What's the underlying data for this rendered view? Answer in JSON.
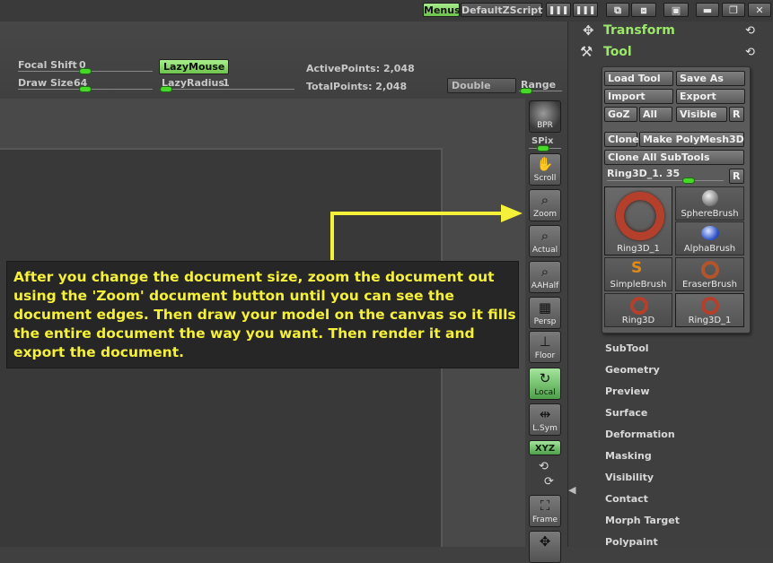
{
  "topbar": {
    "menus_label": "Menus",
    "zscript_label": "DefaultZScript"
  },
  "shelf": {
    "focal_shift_label": "Focal Shift",
    "focal_shift_value": "0",
    "draw_size_label": "Draw Size",
    "draw_size_value": "64",
    "lazymouse_label": "LazyMouse",
    "lazyradius_label": "LazyRadius",
    "lazyradius_value": "1",
    "active_points": "ActivePoints: 2,048",
    "total_points": "TotalPoints: 2,048",
    "double_label": "Double",
    "range_label": "Range"
  },
  "strip": {
    "bpr": "BPR",
    "spix": "SPix",
    "scroll": "Scroll",
    "zoom": "Zoom",
    "actual": "Actual",
    "aahalf": "AAHalf",
    "persp": "Persp",
    "floor": "Floor",
    "local": "Local",
    "lsym": "L.Sym",
    "xyz": "XYZ",
    "frame": "Frame"
  },
  "panel": {
    "transform": "Transform",
    "tool": "Tool",
    "load_tool": "Load Tool",
    "save_as": "Save As",
    "import": "Import",
    "export": "Export",
    "goz": "GoZ",
    "all": "All",
    "visible": "Visible",
    "r": "R",
    "clone": "Clone",
    "make_polymesh": "Make PolyMesh3D",
    "clone_all": "Clone All SubTools",
    "current_tool": "Ring3D_1. 35",
    "thumbs": [
      "Ring3D_1",
      "SphereBrush",
      "AlphaBrush",
      "SimpleBrush",
      "EraserBrush",
      "Ring3D",
      "Ring3D_1"
    ],
    "sections": [
      "SubTool",
      "Geometry",
      "Preview",
      "Surface",
      "Deformation",
      "Masking",
      "Visibility",
      "Contact",
      "Morph Target",
      "Polypaint"
    ]
  },
  "callout": {
    "text": "After you change the document size, zoom the document out using the 'Zoom' document button until you can see the document edges. Then draw your model on the canvas so it fills the entire document the way you want. Then render it and export the document."
  },
  "colors": {
    "accent_green": "#9be86a",
    "slider_knob": "#47d82a",
    "callout_text": "#f5f03a"
  }
}
